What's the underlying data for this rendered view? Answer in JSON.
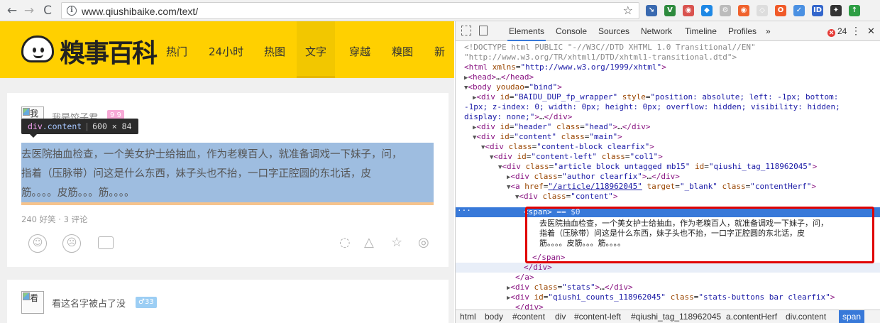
{
  "browser": {
    "url": "www.qiushibaike.com/text/",
    "back": "←",
    "forward": "→",
    "reload": "C",
    "info": "i",
    "bookmark": "☆",
    "extensions": [
      {
        "name": "extension-1-icon",
        "glyph": "↘",
        "color": "#3a6ab0"
      },
      {
        "name": "extension-v-icon",
        "glyph": "V",
        "color": "#2e8b3e"
      },
      {
        "name": "extension-2-icon",
        "glyph": "◉",
        "color": "#d9534f"
      },
      {
        "name": "extension-3-icon",
        "glyph": "◆",
        "color": "#1e88e5"
      },
      {
        "name": "extension-4-icon",
        "glyph": "⚙",
        "color": "#bbbbbb"
      },
      {
        "name": "extension-5-icon",
        "glyph": "◉",
        "color": "#f0622d"
      },
      {
        "name": "extension-6-icon",
        "glyph": "◇",
        "color": "#dddddd"
      },
      {
        "name": "extension-7-icon",
        "glyph": "O",
        "color": "#f05a28"
      },
      {
        "name": "extension-8-icon",
        "glyph": "✓",
        "color": "#4a90e2"
      },
      {
        "name": "extension-9-icon",
        "glyph": "ID",
        "color": "#3366cc"
      },
      {
        "name": "extension-10-icon",
        "glyph": "✦",
        "color": "#333333"
      },
      {
        "name": "extension-11-icon",
        "glyph": "↑",
        "color": "#2e9e44"
      }
    ]
  },
  "site": {
    "logo_text": "糗事百科",
    "nav": [
      "热门",
      "24小时",
      "热图",
      "文字",
      "穿越",
      "糗图",
      "新鲜"
    ],
    "active_nav_index": 3,
    "brand_color": "#ffd000"
  },
  "post1": {
    "avatar_alt": "我",
    "author": "我是饺子君",
    "age_badge": "9 9",
    "content_lines": [
      "去医院抽血检查，一个美女护士给抽血，作为老糗百人，就准备调戏一下妹子，问，",
      "指着（压脉带）问这是什么东西，妹子头也不抬，一口字正腔圆的东北话，皮",
      "筋。。。。皮筋。。。筋。。。。"
    ],
    "stats": "240 好笑 · 3 评论"
  },
  "post2": {
    "avatar_alt": "看",
    "author": "看这名字被占了没",
    "age_badge": "♂33"
  },
  "inspect_tooltip": {
    "tag": "div",
    "cls": ".content",
    "size": "600 × 84"
  },
  "devtools": {
    "tabs": [
      "Elements",
      "Console",
      "Sources",
      "Network",
      "Timeline",
      "Profiles"
    ],
    "more": "»",
    "error_count": "24",
    "menu": "⋮",
    "close": "✕",
    "selected_suffix": " == $0",
    "breadcrumbs": [
      "html",
      "body",
      "#content",
      "div",
      "#content-left",
      "#qiushi_tag_118962045",
      "a.contentHerf",
      "div.content",
      "span"
    ]
  }
}
